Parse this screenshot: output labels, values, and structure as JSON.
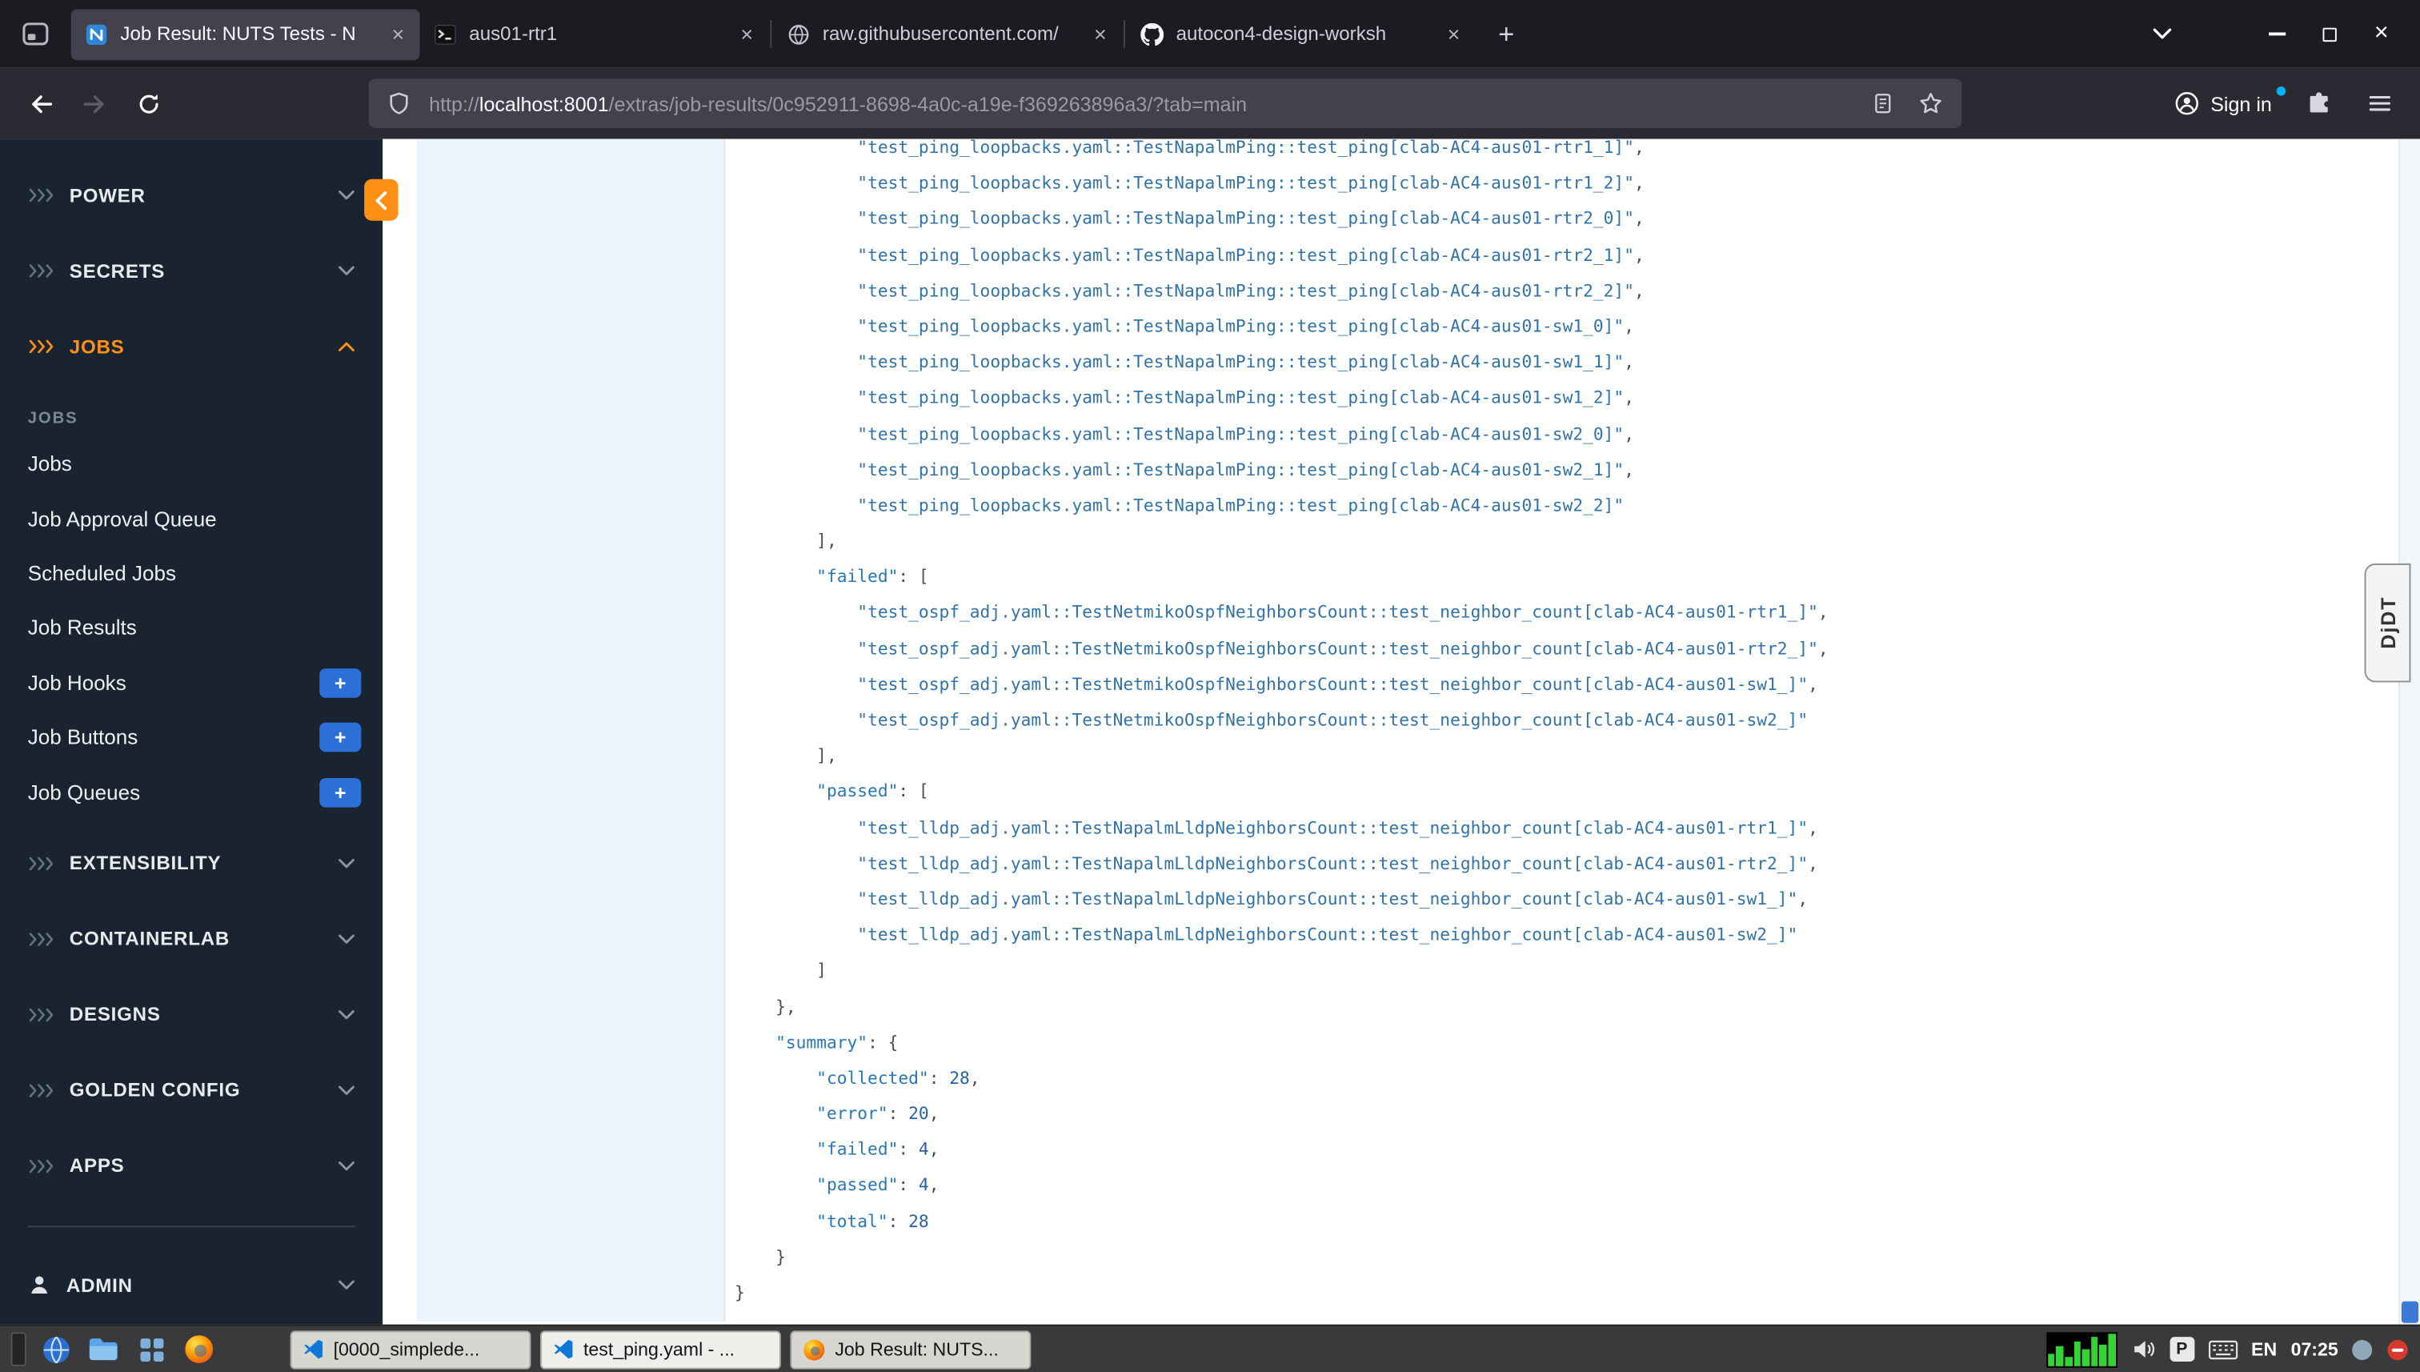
{
  "browser": {
    "tabs": [
      {
        "label": "Job Result: NUTS Tests - N",
        "icon": "nautobot",
        "active": true
      },
      {
        "label": "aus01-rtr1",
        "icon": "terminal",
        "active": false
      },
      {
        "label": "raw.githubusercontent.com/",
        "icon": "page",
        "active": false
      },
      {
        "label": "autocon4-design-worksh",
        "icon": "github",
        "active": false
      }
    ],
    "url_scheme": "http://",
    "url_host": "localhost:8001",
    "url_path": "/extras/job-results/0c952911-8698-4a0c-a19e-f369263896a3/?tab=main",
    "sign_in_label": "Sign in"
  },
  "sidebar": {
    "top_groups": [
      {
        "label": "POWER",
        "expanded": false,
        "active": false
      },
      {
        "label": "SECRETS",
        "expanded": false,
        "active": false
      },
      {
        "label": "JOBS",
        "expanded": true,
        "active": true
      }
    ],
    "section_label": "JOBS",
    "items": [
      {
        "label": "Jobs",
        "add": false
      },
      {
        "label": "Job Approval Queue",
        "add": false
      },
      {
        "label": "Scheduled Jobs",
        "add": false
      },
      {
        "label": "Job Results",
        "add": false
      },
      {
        "label": "Job Hooks",
        "add": true
      },
      {
        "label": "Job Buttons",
        "add": true
      },
      {
        "label": "Job Queues",
        "add": true
      }
    ],
    "bottom_groups": [
      {
        "label": "EXTENSIBILITY",
        "expanded": false,
        "active": false
      },
      {
        "label": "CONTAINERLAB",
        "expanded": false,
        "active": false
      },
      {
        "label": "DESIGNS",
        "expanded": false,
        "active": false
      },
      {
        "label": "GOLDEN CONFIG",
        "expanded": false,
        "active": false
      },
      {
        "label": "APPS",
        "expanded": false,
        "active": false
      }
    ],
    "admin_label": "ADMIN"
  },
  "output": {
    "lines": [
      {
        "i": 12,
        "t": [
          [
            "s",
            "\"test_ping_loopbacks.yaml::TestNapalmPing::test_ping[clab-AC4-aus01-rtr1_1]\""
          ],
          [
            "p",
            ","
          ]
        ]
      },
      {
        "i": 12,
        "t": [
          [
            "s",
            "\"test_ping_loopbacks.yaml::TestNapalmPing::test_ping[clab-AC4-aus01-rtr1_2]\""
          ],
          [
            "p",
            ","
          ]
        ]
      },
      {
        "i": 12,
        "t": [
          [
            "s",
            "\"test_ping_loopbacks.yaml::TestNapalmPing::test_ping[clab-AC4-aus01-rtr2_0]\""
          ],
          [
            "p",
            ","
          ]
        ]
      },
      {
        "i": 12,
        "t": [
          [
            "s",
            "\"test_ping_loopbacks.yaml::TestNapalmPing::test_ping[clab-AC4-aus01-rtr2_1]\""
          ],
          [
            "p",
            ","
          ]
        ]
      },
      {
        "i": 12,
        "t": [
          [
            "s",
            "\"test_ping_loopbacks.yaml::TestNapalmPing::test_ping[clab-AC4-aus01-rtr2_2]\""
          ],
          [
            "p",
            ","
          ]
        ]
      },
      {
        "i": 12,
        "t": [
          [
            "s",
            "\"test_ping_loopbacks.yaml::TestNapalmPing::test_ping[clab-AC4-aus01-sw1_0]\""
          ],
          [
            "p",
            ","
          ]
        ]
      },
      {
        "i": 12,
        "t": [
          [
            "s",
            "\"test_ping_loopbacks.yaml::TestNapalmPing::test_ping[clab-AC4-aus01-sw1_1]\""
          ],
          [
            "p",
            ","
          ]
        ]
      },
      {
        "i": 12,
        "t": [
          [
            "s",
            "\"test_ping_loopbacks.yaml::TestNapalmPing::test_ping[clab-AC4-aus01-sw1_2]\""
          ],
          [
            "p",
            ","
          ]
        ]
      },
      {
        "i": 12,
        "t": [
          [
            "s",
            "\"test_ping_loopbacks.yaml::TestNapalmPing::test_ping[clab-AC4-aus01-sw2_0]\""
          ],
          [
            "p",
            ","
          ]
        ]
      },
      {
        "i": 12,
        "t": [
          [
            "s",
            "\"test_ping_loopbacks.yaml::TestNapalmPing::test_ping[clab-AC4-aus01-sw2_1]\""
          ],
          [
            "p",
            ","
          ]
        ]
      },
      {
        "i": 12,
        "t": [
          [
            "s",
            "\"test_ping_loopbacks.yaml::TestNapalmPing::test_ping[clab-AC4-aus01-sw2_2]\""
          ]
        ]
      },
      {
        "i": 8,
        "t": [
          [
            "p",
            "],"
          ]
        ]
      },
      {
        "i": 8,
        "t": [
          [
            "k",
            "\"failed\""
          ],
          [
            "p",
            ": ["
          ]
        ]
      },
      {
        "i": 12,
        "t": [
          [
            "s",
            "\"test_ospf_adj.yaml::TestNetmikoOspfNeighborsCount::test_neighbor_count[clab-AC4-aus01-rtr1_]\""
          ],
          [
            "p",
            ","
          ]
        ]
      },
      {
        "i": 12,
        "t": [
          [
            "s",
            "\"test_ospf_adj.yaml::TestNetmikoOspfNeighborsCount::test_neighbor_count[clab-AC4-aus01-rtr2_]\""
          ],
          [
            "p",
            ","
          ]
        ]
      },
      {
        "i": 12,
        "t": [
          [
            "s",
            "\"test_ospf_adj.yaml::TestNetmikoOspfNeighborsCount::test_neighbor_count[clab-AC4-aus01-sw1_]\""
          ],
          [
            "p",
            ","
          ]
        ]
      },
      {
        "i": 12,
        "t": [
          [
            "s",
            "\"test_ospf_adj.yaml::TestNetmikoOspfNeighborsCount::test_neighbor_count[clab-AC4-aus01-sw2_]\""
          ]
        ]
      },
      {
        "i": 8,
        "t": [
          [
            "p",
            "],"
          ]
        ]
      },
      {
        "i": 8,
        "t": [
          [
            "k",
            "\"passed\""
          ],
          [
            "p",
            ": ["
          ]
        ]
      },
      {
        "i": 12,
        "t": [
          [
            "s",
            "\"test_lldp_adj.yaml::TestNapalmLldpNeighborsCount::test_neighbor_count[clab-AC4-aus01-rtr1_]\""
          ],
          [
            "p",
            ","
          ]
        ]
      },
      {
        "i": 12,
        "t": [
          [
            "s",
            "\"test_lldp_adj.yaml::TestNapalmLldpNeighborsCount::test_neighbor_count[clab-AC4-aus01-rtr2_]\""
          ],
          [
            "p",
            ","
          ]
        ]
      },
      {
        "i": 12,
        "t": [
          [
            "s",
            "\"test_lldp_adj.yaml::TestNapalmLldpNeighborsCount::test_neighbor_count[clab-AC4-aus01-sw1_]\""
          ],
          [
            "p",
            ","
          ]
        ]
      },
      {
        "i": 12,
        "t": [
          [
            "s",
            "\"test_lldp_adj.yaml::TestNapalmLldpNeighborsCount::test_neighbor_count[clab-AC4-aus01-sw2_]\""
          ]
        ]
      },
      {
        "i": 8,
        "t": [
          [
            "p",
            "]"
          ]
        ]
      },
      {
        "i": 4,
        "t": [
          [
            "p",
            "},"
          ]
        ]
      },
      {
        "i": 4,
        "t": [
          [
            "k",
            "\"summary\""
          ],
          [
            "p",
            ": {"
          ]
        ]
      },
      {
        "i": 8,
        "t": [
          [
            "k",
            "\"collected\""
          ],
          [
            "p",
            ": "
          ],
          [
            "n",
            "28"
          ],
          [
            "p",
            ","
          ]
        ]
      },
      {
        "i": 8,
        "t": [
          [
            "k",
            "\"error\""
          ],
          [
            "p",
            ": "
          ],
          [
            "n",
            "20"
          ],
          [
            "p",
            ","
          ]
        ]
      },
      {
        "i": 8,
        "t": [
          [
            "k",
            "\"failed\""
          ],
          [
            "p",
            ": "
          ],
          [
            "n",
            "4"
          ],
          [
            "p",
            ","
          ]
        ]
      },
      {
        "i": 8,
        "t": [
          [
            "k",
            "\"passed\""
          ],
          [
            "p",
            ": "
          ],
          [
            "n",
            "4"
          ],
          [
            "p",
            ","
          ]
        ]
      },
      {
        "i": 8,
        "t": [
          [
            "k",
            "\"total\""
          ],
          [
            "p",
            ": "
          ],
          [
            "n",
            "28"
          ]
        ]
      },
      {
        "i": 4,
        "t": [
          [
            "p",
            "}"
          ]
        ]
      },
      {
        "i": 0,
        "t": [
          [
            "p",
            "}"
          ]
        ]
      }
    ]
  },
  "debug_toolbar_label": "DjDT",
  "taskbar": {
    "windows": [
      {
        "label": "[0000_simplede...",
        "icon": "vscode",
        "active": false
      },
      {
        "label": "test_ping.yaml - ...",
        "icon": "vscode",
        "active": true
      },
      {
        "label": "Job Result: NUTS...",
        "icon": "firefox",
        "active": false
      }
    ],
    "language": "EN",
    "clock": "07:25",
    "tray_letter": "P"
  },
  "colors": {
    "accent_orange": "#ff9015",
    "add_button_blue": "#2d6fd9",
    "sidebar_bg": "#1a2430",
    "code_key": "#2878b8",
    "code_string": "#3173a9",
    "code_number": "#2661a8",
    "code_punct": "#4a4f54",
    "scroll_thumb_blue": "#3d79d6"
  }
}
